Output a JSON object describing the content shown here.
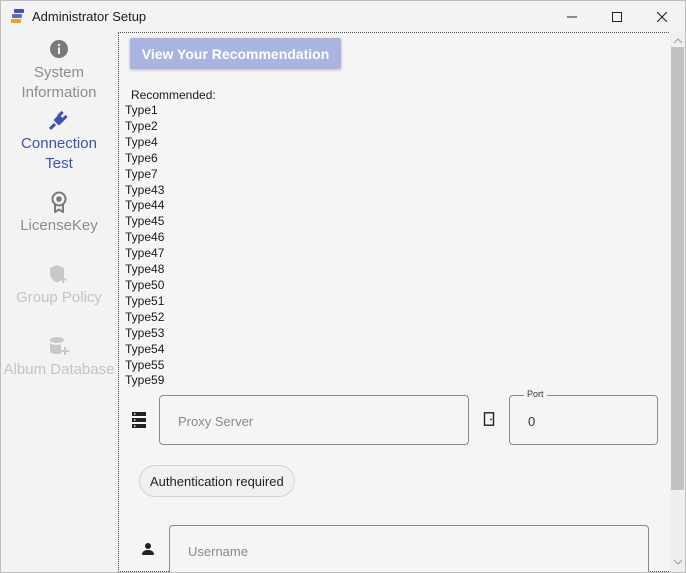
{
  "window": {
    "title": "Administrator Setup",
    "controls": [
      "minimize",
      "maximize",
      "close"
    ]
  },
  "sidebar": {
    "items": [
      {
        "label_line1": "System",
        "label_line2": "Information",
        "icon": "info-icon",
        "state": "normal"
      },
      {
        "label_line1": "Connection",
        "label_line2": "Test",
        "icon": "plug-icon",
        "state": "active"
      },
      {
        "label_line1": "LicenseKey",
        "label_line2": "",
        "icon": "badge-icon",
        "state": "normal"
      },
      {
        "label_line1": "Group Policy",
        "label_line2": "",
        "icon": "shield-add-icon",
        "state": "disabled"
      },
      {
        "label_line1": "Album Database",
        "label_line2": "",
        "icon": "database-add-icon",
        "state": "disabled"
      }
    ]
  },
  "main": {
    "recommend_button": "View Your Recommendation",
    "recommended_label": "Recommended:",
    "types": [
      "Type1",
      "Type2",
      "Type4",
      "Type6",
      "Type7",
      "Type43",
      "Type44",
      "Type45",
      "Type46",
      "Type47",
      "Type48",
      "Type50",
      "Type51",
      "Type52",
      "Type53",
      "Type54",
      "Type55",
      "Type59"
    ],
    "proxy": {
      "placeholder": "Proxy Server",
      "value": ""
    },
    "port": {
      "legend": "Port",
      "value": "0"
    },
    "auth_chip": "Authentication required",
    "username": {
      "placeholder": "Username",
      "value": ""
    }
  },
  "colors": {
    "accent": "#3f51b5",
    "button_disabled_bg": "#aab4e1",
    "muted_text": "#8c8c8c",
    "disabled_text": "#c4c4c4"
  }
}
